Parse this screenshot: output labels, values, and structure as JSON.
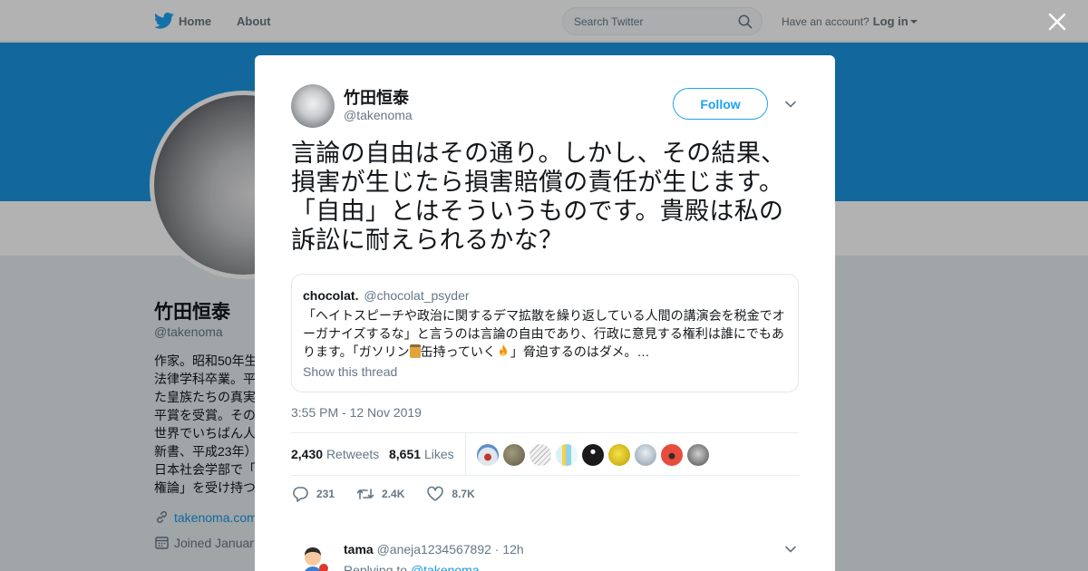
{
  "topbar": {
    "home_label": "Home",
    "about_label": "About",
    "search_placeholder": "Search Twitter",
    "have_account": "Have an account?",
    "login_label": "Log in"
  },
  "profile": {
    "name": "竹田恒泰",
    "handle": "@takenoma",
    "bio": "作家。昭和50年生\n法律学科卒業。平\nた皇族たちの真実\n平賞を受賞。その\n世界でいちばん人\n新書、平成23年）\n日本社会学部で「\n権論」を受け持つ",
    "link": "takenoma.com",
    "joined": "Joined Januar"
  },
  "tweet": {
    "author_name": "竹田恒泰",
    "author_handle": "@takenoma",
    "follow_label": "Follow",
    "text": "言論の自由はその通り。しかし、その結果、損害が生じたら損害賠償の責任が生じます。「自由」とはそういうものです。貴殿は私の訴訟に耐えられるかな？",
    "quote": {
      "name": "chocolat.",
      "handle": "@chocolat_psyder",
      "text_part1": "「ヘイトスピーチや政治に関するデマ拡散を繰り返している人間の講演会を税金でオーガナイズするな」と言うのは言論の自由であり、行政に意見する権利は誰にでもあります。「ガソリン",
      "text_part2": "缶持っていく",
      "text_part3": "」脅迫するのはダメ。…",
      "show_thread": "Show this thread"
    },
    "timestamp": "3:55 PM - 12 Nov 2019",
    "retweets_count": "2,430",
    "retweets_label": "Retweets",
    "likes_count": "8,651",
    "likes_label": "Likes",
    "actions": {
      "reply_count": "231",
      "retweet_count": "2.4K",
      "like_count": "8.7K"
    }
  },
  "reply": {
    "name": "tama",
    "handle": "@aneja1234567892",
    "time": "· 12h",
    "replying_to_label": "Replying to",
    "replying_to_handle": "@takenoma"
  },
  "colors": {
    "accent": "#1da1f2",
    "banner": "#1b95e0",
    "overlay": "rgba(0,0,0,0.3)"
  }
}
